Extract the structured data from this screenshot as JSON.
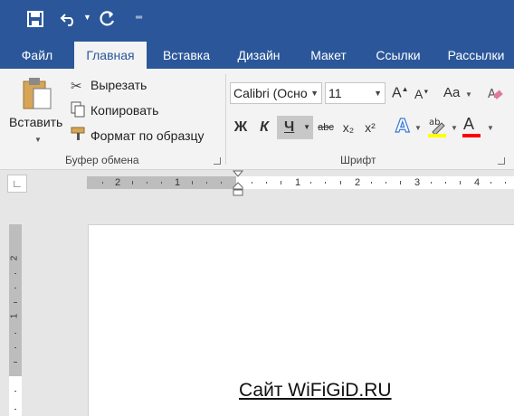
{
  "quick_access": {
    "save_icon": "save-icon",
    "undo_icon": "undo-icon",
    "redo_icon": "redo-icon",
    "customize_icon": "customize-qat-icon"
  },
  "tabs": [
    {
      "label": "Файл"
    },
    {
      "label": "Главная"
    },
    {
      "label": "Вставка"
    },
    {
      "label": "Дизайн"
    },
    {
      "label": "Макет"
    },
    {
      "label": "Ссылки"
    },
    {
      "label": "Рассылки"
    }
  ],
  "clipboard": {
    "paste_label": "Вставить",
    "cut_label": "Вырезать",
    "copy_label": "Копировать",
    "format_painter_label": "Формат по образцу",
    "group_label": "Буфер обмена"
  },
  "font": {
    "font_name": "Calibri (Осно",
    "font_size": "11",
    "bold": "Ж",
    "italic": "К",
    "underline": "Ч",
    "strike": "abc",
    "subscript": "x₂",
    "superscript": "x²",
    "grow": "A",
    "shrink": "A",
    "case": "Aa",
    "color_letter": "A",
    "group_label": "Шрифт"
  },
  "ruler": {
    "numbers_left": [
      "2",
      "1"
    ],
    "numbers_right": [
      "1",
      "2",
      "3",
      "4"
    ],
    "vertical_numbers": [
      "2",
      "1"
    ]
  },
  "document": {
    "text": "Сайт WiFiGiD.RU"
  },
  "colors": {
    "brand": "#2b579a",
    "highlight": "#ffff00",
    "font_color": "#ff0000"
  }
}
